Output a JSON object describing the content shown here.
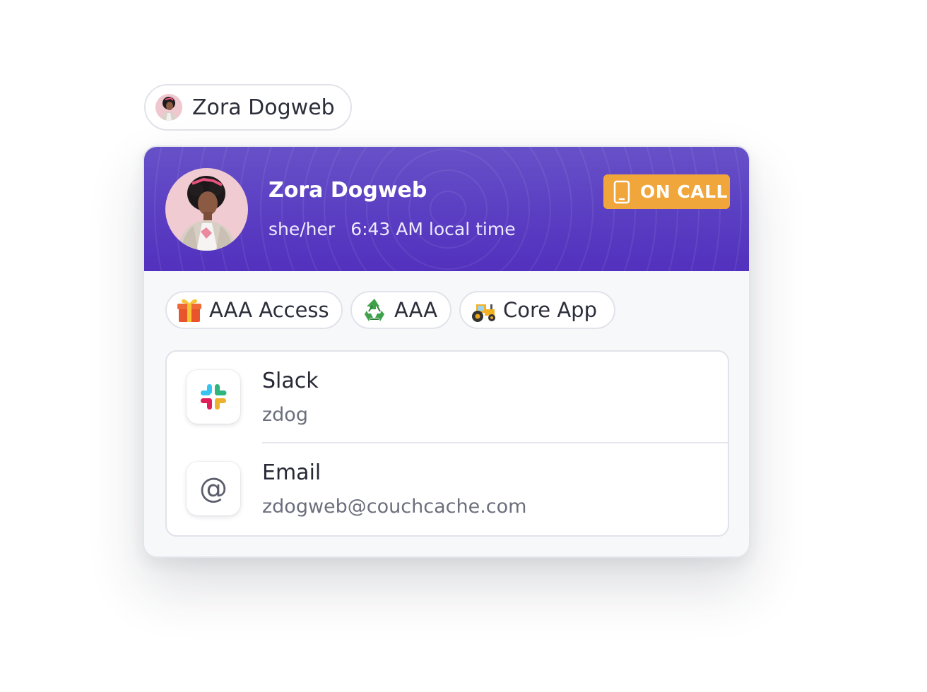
{
  "mention": {
    "name": "Zora Dogweb",
    "avatar_icon": "user-avatar"
  },
  "profile": {
    "name": "Zora Dogweb",
    "pronouns": "she/her",
    "local_time": "6:43 AM local time",
    "badge": {
      "label": "ON CALL",
      "icon": "mobile-phone-icon",
      "color": "#f0a63a"
    },
    "header_colors": [
      "#6751c8",
      "#5231be"
    ]
  },
  "tags": [
    {
      "emoji": "gift-emoji",
      "label": "AAA Access"
    },
    {
      "emoji": "recycle-emoji",
      "label": "AAA"
    },
    {
      "emoji": "tractor-emoji",
      "label": "Core App"
    }
  ],
  "contacts": [
    {
      "icon": "slack-icon",
      "title": "Slack",
      "value": "zdog"
    },
    {
      "icon": "at-sign-icon",
      "title": "Email",
      "value": "zdogweb@couchcache.com"
    }
  ]
}
